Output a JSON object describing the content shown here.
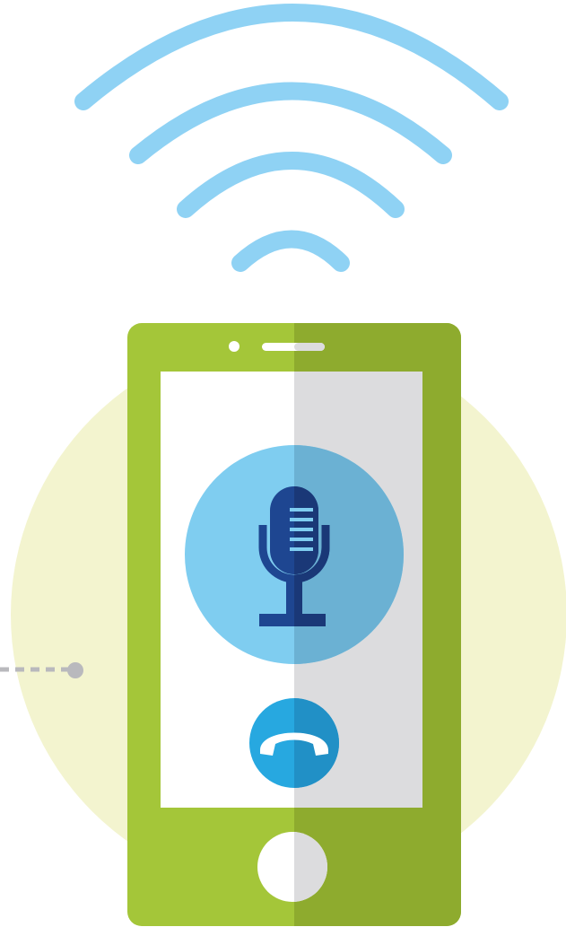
{
  "illustration": {
    "colors": {
      "background": "#ffffff",
      "backdrop_circle": "#f3f4cf",
      "signal_arcs": "#8fd2f4",
      "phone_body_light": "#a4c639",
      "phone_body_dark": "#8eab2e",
      "screen_light": "#ffffff",
      "screen_dark": "#dcdcde",
      "mic_circle_light": "#7fcdf0",
      "mic_circle_dark": "#6bb1d3",
      "mic_light": "#1e4691",
      "mic_dark": "#1a3877",
      "end_call_button_light": "#27a8e0",
      "end_call_button_dark": "#2190c6",
      "home_button_light": "#ffffff",
      "home_button_dark": "#dcdcde",
      "connector_dots": "#b9b9bd"
    },
    "icons": [
      "wifi-signal-icon",
      "microphone-icon",
      "phone-hangup-icon",
      "home-button"
    ],
    "signal_arc_count": 4
  }
}
